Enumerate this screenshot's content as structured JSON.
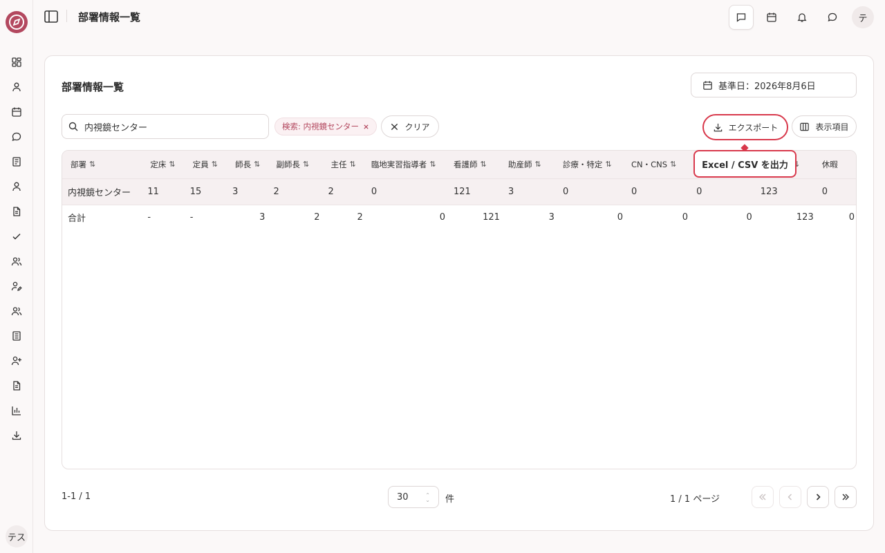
{
  "app": {
    "logo": "compass-logo-icon",
    "accent": "#b3485f",
    "highlight": "#d8384b"
  },
  "rail": {
    "items": [
      "dashboard-icon",
      "user-icon",
      "calendar-icon",
      "chat-icon",
      "book-icon",
      "person-icon",
      "document-icon",
      "check-icon",
      "users-icon",
      "user-edit-icon",
      "group-icon",
      "list-icon",
      "user-plus-icon",
      "file-icon",
      "bar-chart-icon",
      "download-icon"
    ],
    "avatar": "テス"
  },
  "header": {
    "title": "部署情報一覧",
    "actions": [
      "message-square-icon",
      "calendar-icon",
      "bell-icon",
      "chat-bubble-icon"
    ],
    "avatar": "テ"
  },
  "card": {
    "title": "部署情報一覧",
    "date_label": "基準日：2026年8月6日",
    "search_value": "内視鏡センター",
    "chip_label": "検索: 内視鏡センター",
    "clear_label": "クリア",
    "export_label": "エクスポート",
    "columns_label": "表示項目",
    "tooltip": "Excel / CSV を出力"
  },
  "table": {
    "headers": [
      "部署",
      "定床",
      "定員",
      "師長",
      "副師長",
      "主任",
      "臨地実習指導者",
      "看護師",
      "助産師",
      "診療・特定",
      "CN・CNS",
      "",
      "無し",
      "休暇"
    ],
    "sort_glyph": "⇅",
    "rows": [
      [
        "内視鏡センター",
        "11",
        "15",
        "3",
        "2",
        "2",
        "0",
        "121",
        "3",
        "0",
        "0",
        "0",
        "123",
        "0"
      ]
    ],
    "total": [
      "合計",
      "-",
      "-",
      "3",
      "2",
      "2",
      "0",
      "121",
      "3",
      "0",
      "0",
      "0",
      "123",
      "0"
    ]
  },
  "pagination": {
    "count": "1-1 / 1",
    "page_size": "30",
    "unit": "件",
    "page_info": "1 / 1 ページ"
  }
}
